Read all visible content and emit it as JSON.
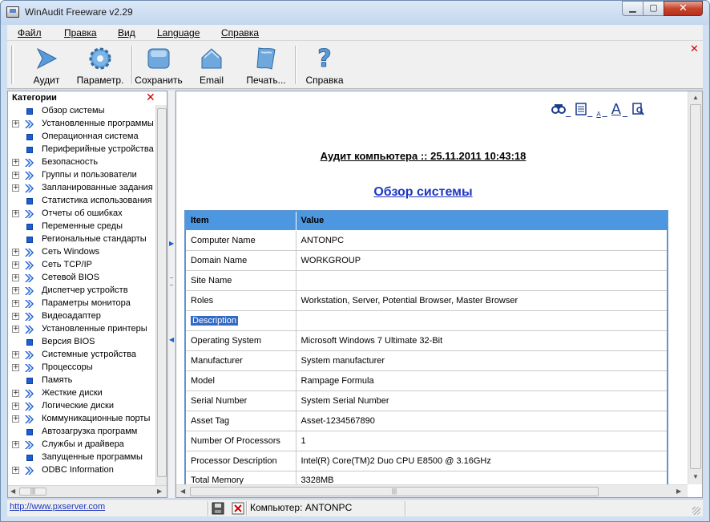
{
  "window": {
    "title": "WinAudit Freeware v2.29"
  },
  "menu": [
    "Файл",
    "Правка",
    "Вид",
    "Language",
    "Справка"
  ],
  "toolbar": [
    {
      "label": "Аудит",
      "icon": "play-arrow-icon"
    },
    {
      "label": "Параметр.",
      "icon": "gear-icon"
    },
    {
      "label": "Сохранить",
      "icon": "save-icon"
    },
    {
      "label": "Email",
      "icon": "email-house-icon"
    },
    {
      "label": "Печать...",
      "icon": "print-icon"
    },
    {
      "label": "Справка",
      "icon": "help-question-icon"
    }
  ],
  "categories": {
    "header": "Категории",
    "items": [
      {
        "label": "Обзор системы",
        "expandable": false
      },
      {
        "label": "Установленные программы",
        "expandable": true
      },
      {
        "label": "Операционная система",
        "expandable": false
      },
      {
        "label": "Периферийные устройства",
        "expandable": false
      },
      {
        "label": "Безопасность",
        "expandable": true
      },
      {
        "label": "Группы и пользователи",
        "expandable": true
      },
      {
        "label": "Запланированные задания",
        "expandable": true
      },
      {
        "label": "Статистика использования",
        "expandable": false
      },
      {
        "label": "Отчеты об ошибках",
        "expandable": true
      },
      {
        "label": "Переменные среды",
        "expandable": false
      },
      {
        "label": "Региональные стандарты",
        "expandable": false
      },
      {
        "label": "Сеть Windows",
        "expandable": true
      },
      {
        "label": "Сеть TCP/IP",
        "expandable": true
      },
      {
        "label": "Сетевой BIOS",
        "expandable": true
      },
      {
        "label": "Диспетчер устройств",
        "expandable": true
      },
      {
        "label": "Параметры монитора",
        "expandable": true
      },
      {
        "label": "Видеоадаптер",
        "expandable": true
      },
      {
        "label": "Установленные принтеры",
        "expandable": true
      },
      {
        "label": "Версия BIOS",
        "expandable": false
      },
      {
        "label": "Системные устройства",
        "expandable": true
      },
      {
        "label": "Процессоры",
        "expandable": true
      },
      {
        "label": "Память",
        "expandable": false
      },
      {
        "label": "Жесткие диски",
        "expandable": true
      },
      {
        "label": "Логические диски",
        "expandable": true
      },
      {
        "label": "Коммуникационные порты",
        "expandable": true
      },
      {
        "label": "Автозагрузка программ",
        "expandable": false
      },
      {
        "label": "Службы и драйвера",
        "expandable": true
      },
      {
        "label": "Запущенные программы",
        "expandable": false
      },
      {
        "label": "ODBC Information",
        "expandable": true
      }
    ]
  },
  "report": {
    "audit_title": "Аудит компьютера :: 25.11.2011 10:43:18",
    "section_title": "Обзор системы",
    "columns": [
      "Item",
      "Value"
    ],
    "rows": [
      [
        "Computer Name",
        "ANTONPC"
      ],
      [
        "Domain Name",
        "WORKGROUP"
      ],
      [
        "Site Name",
        ""
      ],
      [
        "Roles",
        "Workstation, Server, Potential Browser, Master Browser"
      ],
      [
        "Description",
        ""
      ],
      [
        "Operating System",
        "Microsoft Windows 7 Ultimate 32-Bit"
      ],
      [
        "Manufacturer",
        "System manufacturer"
      ],
      [
        "Model",
        "Rampage Formula"
      ],
      [
        "Serial Number",
        "System Serial Number"
      ],
      [
        "Asset Tag",
        "Asset-1234567890"
      ],
      [
        "Number Of Processors",
        "1"
      ],
      [
        "Processor Description",
        "Intel(R) Core(TM)2 Duo CPU E8500 @ 3.16GHz"
      ],
      [
        "Total Memory",
        "3328MB"
      ]
    ],
    "selected_row": 4
  },
  "status": {
    "link": "http://www.pxserver.com",
    "text": "Компьютер: ANTONPC"
  }
}
